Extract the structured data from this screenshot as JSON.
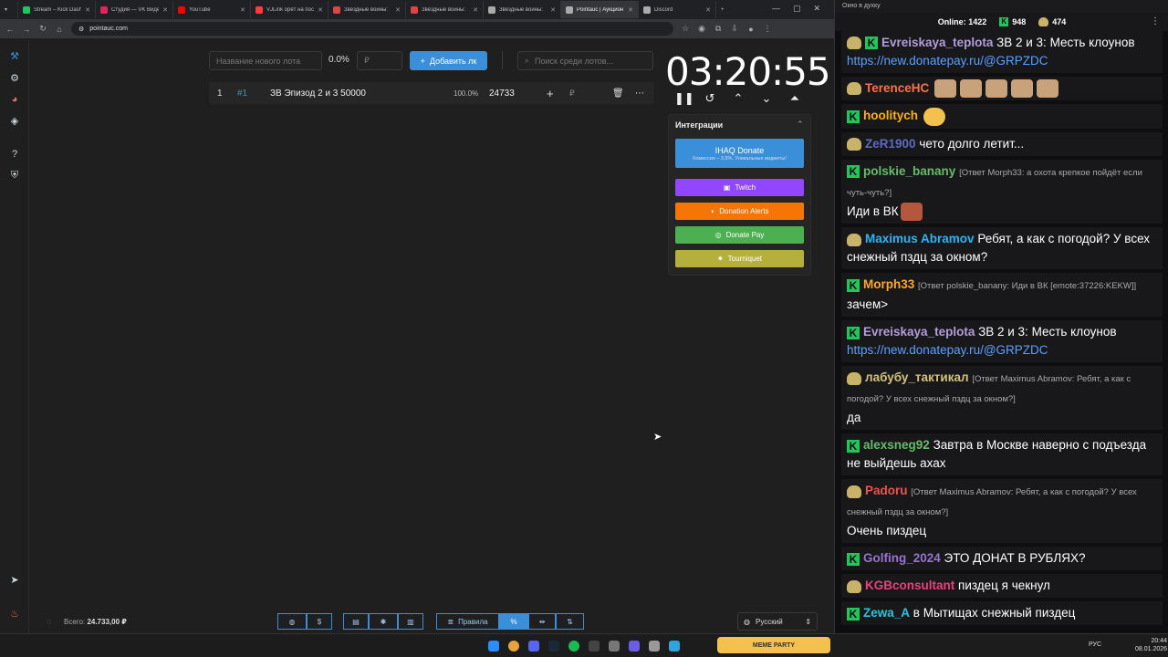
{
  "browser": {
    "tabs": [
      {
        "title": "Stream – Kick Dashb",
        "color": "#22c55e"
      },
      {
        "title": "Студия — VK Видео",
        "color": "#e0245e"
      },
      {
        "title": "YouTube",
        "color": "#ff0000"
      },
      {
        "title": "VJLink орёт на пос",
        "color": "#ff3b3b"
      },
      {
        "title": "Звёздные войны:",
        "color": "#d44"
      },
      {
        "title": "Звёздные войны:",
        "color": "#d44"
      },
      {
        "title": "Звёздные войны:",
        "color": "#aaa"
      },
      {
        "title": "Pointauc | Аукцион",
        "color": "#aaa"
      },
      {
        "title": "Discord",
        "color": "#aaa"
      }
    ],
    "url": "pointauc.com"
  },
  "auction": {
    "new_lot_placeholder": "Название нового лота",
    "percent": "0.0%",
    "amount_placeholder": "₽",
    "add_button": "Добавить лк",
    "search_placeholder": "Поиск среди лотов...",
    "lots": [
      {
        "index": "1",
        "id": "#1",
        "name": "ЗВ Эпизод 2 и 3 50000",
        "percent": "100.0%",
        "amount": "24733",
        "currency": "₽"
      }
    ],
    "timer": "03:20:55",
    "integrations_title": "Интеграции",
    "integrations": {
      "ihaq": {
        "label": "IHAQ Donate",
        "sub": "Комиссия – 3,5%. Уникальные виджеты!",
        "color": "#3b8fd8"
      },
      "twitch": {
        "label": "Twitch",
        "color": "#9147ff"
      },
      "donationalerts": {
        "label": "Donation Alerts",
        "color": "#f57507"
      },
      "donatepay": {
        "label": "Donate Pay",
        "color": "#4caf50"
      },
      "tourniquet": {
        "label": "Tourniquet",
        "color": "#b5b03b"
      }
    },
    "total_label": "Всего:",
    "total_value": "24.733,00 ₽",
    "rules_button": "Правила",
    "language": "Русский"
  },
  "chat": {
    "window_title": "Окно в духку",
    "online_label": "Online:",
    "online_count": "1422",
    "kick_count": "948",
    "other_count": "474",
    "messages": [
      {
        "user": "Evreiskaya_teplota",
        "color": "#b39ddb",
        "text": "ЗВ 2 и 3: Месть клоунов",
        "link": "https://new.donatepay.ru/@GRPZDC"
      },
      {
        "user": "TerenceHC",
        "color": "#ff7043",
        "text": ""
      },
      {
        "user": "hoolitych",
        "color": "#ffb300",
        "text": ""
      },
      {
        "user": "ZeR1900",
        "color": "#5c6bc0",
        "text": "чето долго летит..."
      },
      {
        "user": "polskie_banany",
        "color": "#66bb6a",
        "reply": "[Ответ Morph33: а охота крепкое пойдёт если чуть-чуть?]",
        "text": "Иди в ВК"
      },
      {
        "user": "Maximus Abramov",
        "color": "#29b6f6",
        "text": "Ребят, а как с погодой? У всех снежный пздц за окном?"
      },
      {
        "user": "Morph33",
        "color": "#ffa726",
        "reply": "[Ответ polskie_banany: Иди в ВК [emote:37226:KEKW]]",
        "text": "зачем>"
      },
      {
        "user": "Evreiskaya_teplota",
        "color": "#b39ddb",
        "text": "ЗВ 2 и 3: Месть клоунов",
        "link": "https://new.donatepay.ru/@GRPZDC"
      },
      {
        "user": "лабубу_тактикал",
        "color": "#d4c27a",
        "reply": "[Ответ Maximus Abramov: Ребят, а как с погодой? У всех снежный пздц за окном?]",
        "text": "да"
      },
      {
        "user": "alexsneg92",
        "color": "#66bb6a",
        "text": "Завтра в Москве наверно с подъезда не выйдешь ахах"
      },
      {
        "user": "Padoru",
        "color": "#ef5350",
        "reply": "[Ответ Maximus Abramov: Ребят, а как с погодой? У всех снежный пздц за окном?]",
        "text": "Очень пиздец"
      },
      {
        "user": "Golfing_2024",
        "color": "#9575cd",
        "text": "ЭТО ДОНАТ В РУБЛЯХ?"
      },
      {
        "user": "KGBconsultant",
        "color": "#ec407a",
        "text": "пиздец я чекнул"
      },
      {
        "user": "Zewa_A",
        "color": "#26c6da",
        "text": "в Мытищах снежный пиздец"
      }
    ]
  },
  "taskbar": {
    "lang": "РУС",
    "time": "20:44",
    "date": "08.01.2026",
    "widget": "MEME PARTY"
  }
}
